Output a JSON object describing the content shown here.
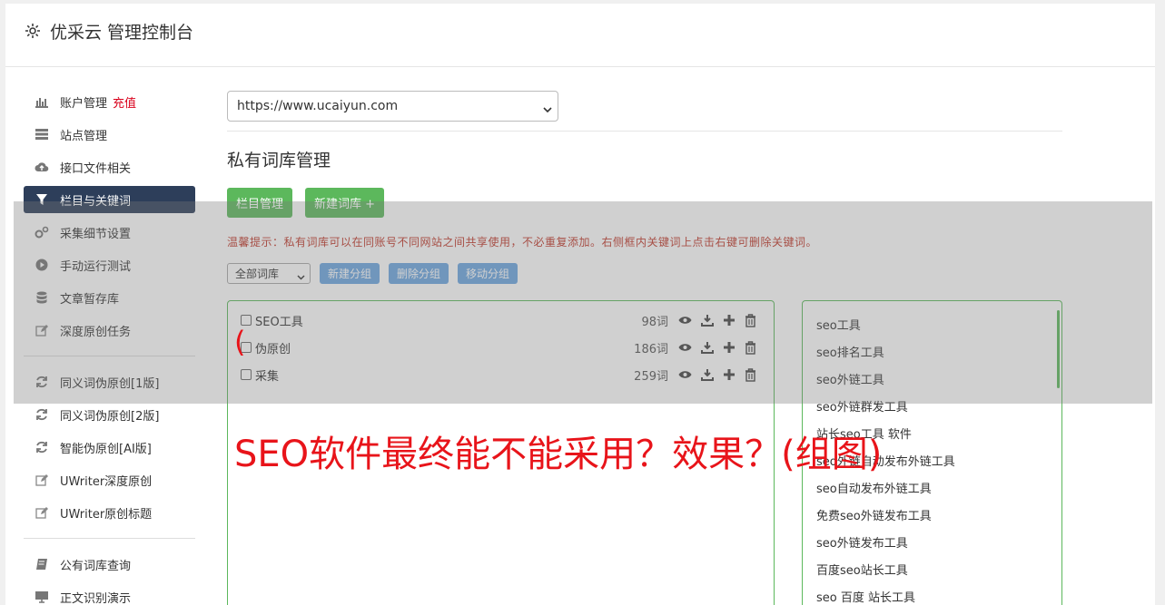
{
  "header": {
    "title": "优采云 管理控制台"
  },
  "sidebar": {
    "items": [
      {
        "label": "账户管理",
        "charge": "充值"
      },
      {
        "label": "站点管理"
      },
      {
        "label": "接口文件相关"
      },
      {
        "label": "栏目与关键词"
      },
      {
        "label": "采集细节设置"
      },
      {
        "label": "手动运行测试"
      },
      {
        "label": "文章暂存库"
      },
      {
        "label": "深度原创任务"
      },
      {
        "label": "同义词伪原创[1版]"
      },
      {
        "label": "同义词伪原创[2版]"
      },
      {
        "label": "智能伪原创[AI版]"
      },
      {
        "label": "UWriter深度原创"
      },
      {
        "label": "UWriter原创标题"
      },
      {
        "label": "公有词库查询"
      },
      {
        "label": "正文识别演示"
      }
    ]
  },
  "main": {
    "site_select": "https://www.ucaiyun.com",
    "page_title": "私有词库管理",
    "buttons": {
      "column_manage": "栏目管理",
      "new_library": "新建词库 +"
    },
    "tip": "温馨提示：私有词库可以在同账号不同网站之间共享使用，不必重复添加。右侧框内关键词上点击右键可删除关键词。",
    "toolbar": {
      "group_select": "全部词库",
      "new_group": "新建分组",
      "delete_group": "删除分组",
      "move_group": "移动分组"
    },
    "libraries": [
      {
        "name": "SEO工具",
        "count": "98词"
      },
      {
        "name": "伪原创",
        "count": "186词"
      },
      {
        "name": "采集",
        "count": "259词"
      }
    ],
    "keywords": [
      "seo工具",
      "seo排名工具",
      "seo外链工具",
      "seo外链群发工具",
      "站长seo工具 软件",
      "seo外链自动发布外链工具",
      "seo自动发布外链工具",
      "免费seo外链发布工具",
      "seo外链发布工具",
      "百度seo站长工具",
      "seo 百度 站长工具"
    ]
  },
  "overlay": {
    "title": "SEO软件最终能不能采用？效果？(组图)",
    "paren": "("
  },
  "colors": {
    "green": "#5cb85c",
    "blue": "#6ca6e0",
    "active_nav": "#2d3e5a",
    "red": "#e8141a"
  }
}
